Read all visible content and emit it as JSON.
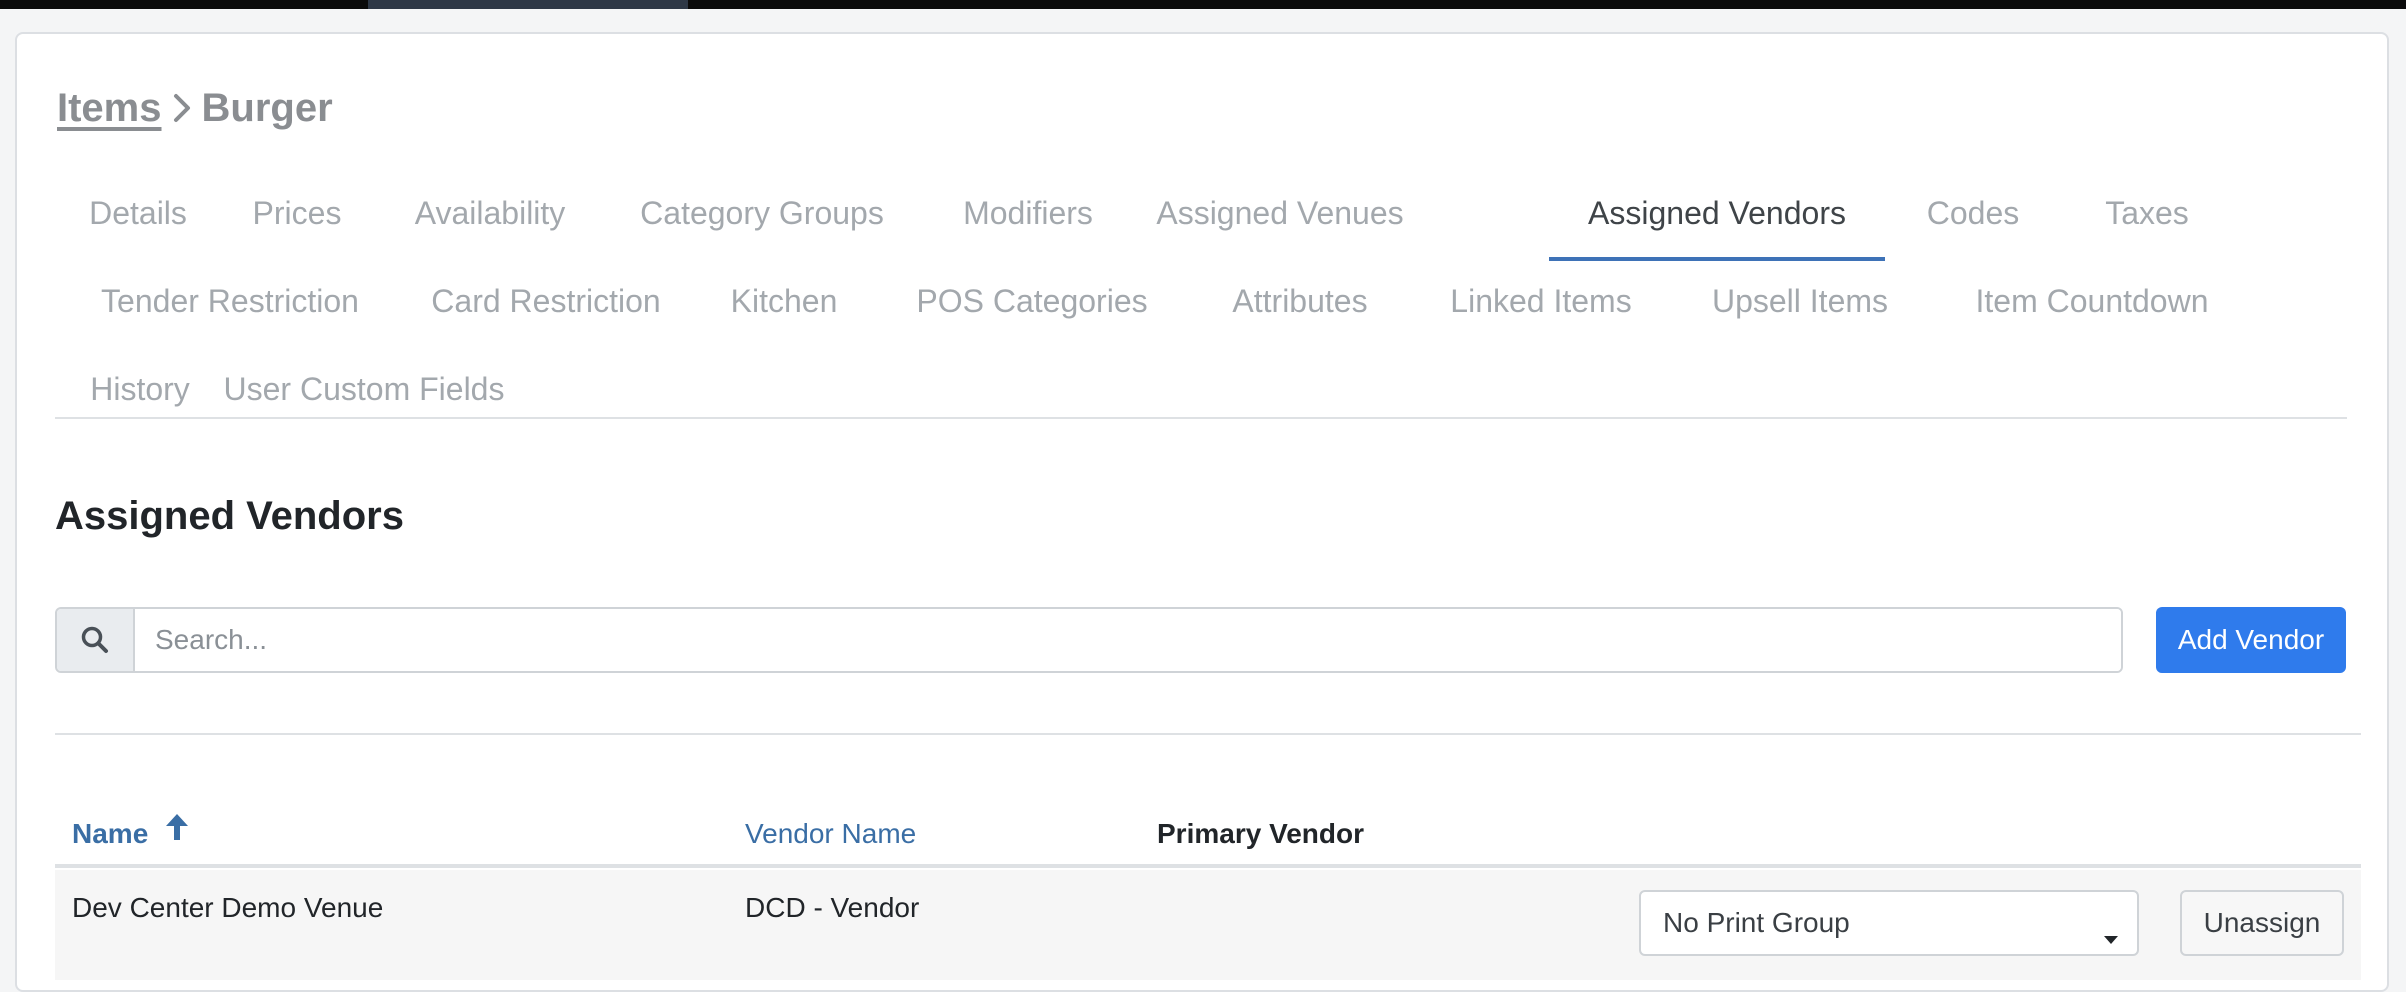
{
  "breadcrumb": {
    "parent": "Items",
    "current": "Burger"
  },
  "tabs": {
    "row1": [
      "Details",
      "Prices",
      "Availability",
      "Category Groups",
      "Modifiers",
      "Assigned Venues",
      "Assigned Vendors",
      "Codes",
      "Taxes"
    ],
    "row2": [
      "Tender Restriction",
      "Card Restriction",
      "Kitchen",
      "POS Categories",
      "Attributes",
      "Linked Items",
      "Upsell Items",
      "Item Countdown"
    ],
    "row3": [
      "History",
      "User Custom Fields"
    ],
    "active": "Assigned Vendors"
  },
  "section": {
    "title": "Assigned Vendors"
  },
  "search": {
    "placeholder": "Search...",
    "value": "",
    "icon": "search-icon"
  },
  "add_vendor_label": "Add Vendor",
  "table": {
    "columns": {
      "name": "Name",
      "vendor_name": "Vendor Name",
      "primary_vendor": "Primary Vendor"
    },
    "sort": {
      "column": "Name",
      "direction": "ascending"
    },
    "rows": [
      {
        "name": "Dev Center Demo Venue",
        "vendor_name": "DCD - Vendor",
        "print_group": "No Print Group",
        "action": "Unassign"
      }
    ]
  },
  "colors": {
    "accent": "#2f7bec",
    "link": "#3a6ea5",
    "active_tab_underline": "#3e72b7"
  }
}
